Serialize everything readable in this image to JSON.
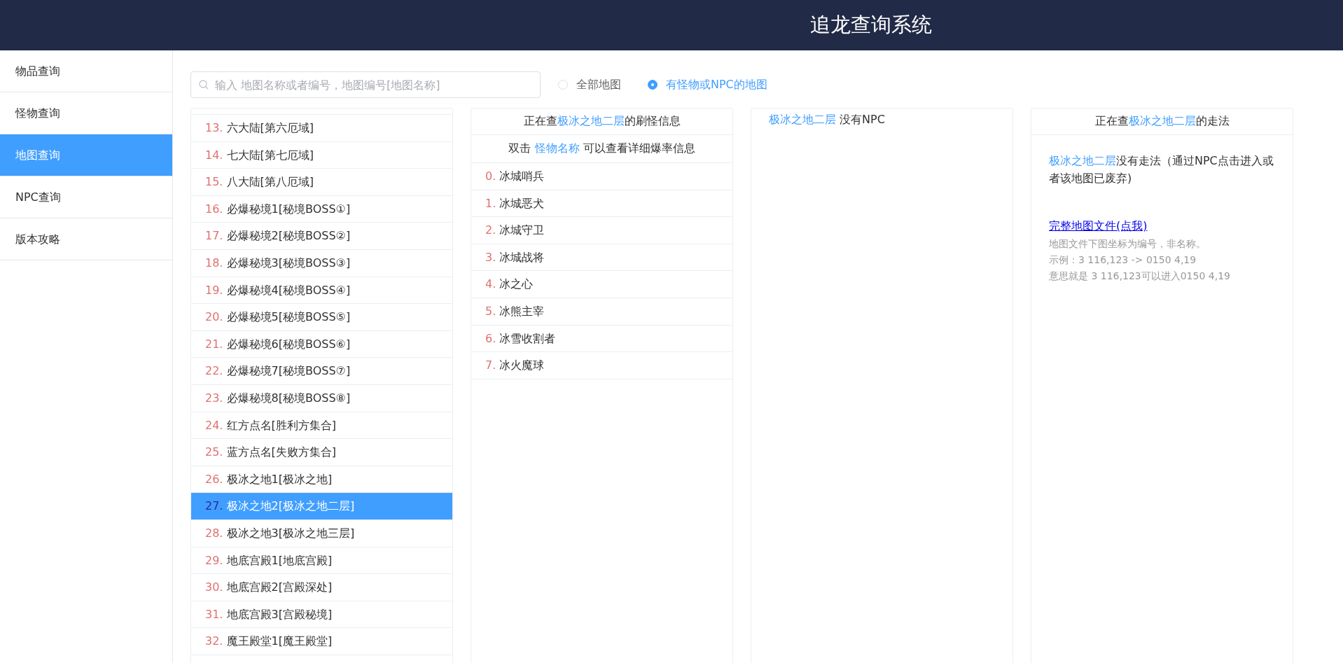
{
  "header": {
    "title": "追龙查询系统"
  },
  "sidebar": {
    "items": [
      {
        "label": "物品查询",
        "selected": false
      },
      {
        "label": "怪物查询",
        "selected": false
      },
      {
        "label": "地图查询",
        "selected": true
      },
      {
        "label": "NPC查询",
        "selected": false
      },
      {
        "label": "版本攻略",
        "selected": false
      }
    ]
  },
  "search": {
    "placeholder": "输入 地图名称或者编号，地图编号[地图名称]"
  },
  "filters": [
    {
      "label": "全部地图",
      "selected": false
    },
    {
      "label": "有怪物或NPC的地图",
      "selected": true
    }
  ],
  "map_list": [
    {
      "number": "13.",
      "name": "六大陆[第六厄域]",
      "selected": false
    },
    {
      "number": "14.",
      "name": "七大陆[第七厄域]",
      "selected": false
    },
    {
      "number": "15.",
      "name": "八大陆[第八厄域]",
      "selected": false
    },
    {
      "number": "16.",
      "name": "必爆秘境1[秘境BOSS①]",
      "selected": false
    },
    {
      "number": "17.",
      "name": "必爆秘境2[秘境BOSS②]",
      "selected": false
    },
    {
      "number": "18.",
      "name": "必爆秘境3[秘境BOSS③]",
      "selected": false
    },
    {
      "number": "19.",
      "name": "必爆秘境4[秘境BOSS④]",
      "selected": false
    },
    {
      "number": "20.",
      "name": "必爆秘境5[秘境BOSS⑤]",
      "selected": false
    },
    {
      "number": "21.",
      "name": "必爆秘境6[秘境BOSS⑥]",
      "selected": false
    },
    {
      "number": "22.",
      "name": "必爆秘境7[秘境BOSS⑦]",
      "selected": false
    },
    {
      "number": "23.",
      "name": "必爆秘境8[秘境BOSS⑧]",
      "selected": false
    },
    {
      "number": "24.",
      "name": "红方点名[胜利方集合]",
      "selected": false
    },
    {
      "number": "25.",
      "name": "蓝方点名[失败方集合]",
      "selected": false
    },
    {
      "number": "26.",
      "name": "极冰之地1[极冰之地]",
      "selected": false
    },
    {
      "number": "27.",
      "name": "极冰之地2[极冰之地二层]",
      "selected": true
    },
    {
      "number": "28.",
      "name": "极冰之地3[极冰之地三层]",
      "selected": false
    },
    {
      "number": "29.",
      "name": "地底宫殿1[地底宫殿]",
      "selected": false
    },
    {
      "number": "30.",
      "name": "地底宫殿2[宫殿深处]",
      "selected": false
    },
    {
      "number": "31.",
      "name": "地底宫殿3[宫殿秘境]",
      "selected": false
    },
    {
      "number": "32.",
      "name": "魔王殿堂1[魔王殿堂]",
      "selected": false
    }
  ],
  "monster_panel": {
    "title": {
      "before": "正在查",
      "highlight": "极冰之地二层",
      "after": "的刷怪信息"
    },
    "hint": {
      "before": "双击 ",
      "highlight": "怪物名称",
      "after": " 可以查看详细爆率信息"
    },
    "monsters": [
      {
        "number": "0.",
        "name": "冰城哨兵"
      },
      {
        "number": "1.",
        "name": "冰城恶犬"
      },
      {
        "number": "2.",
        "name": "冰城守卫"
      },
      {
        "number": "3.",
        "name": "冰城战将"
      },
      {
        "number": "4.",
        "name": "冰之心"
      },
      {
        "number": "5.",
        "name": "冰熊主宰"
      },
      {
        "number": "6.",
        "name": "冰雪收割者"
      },
      {
        "number": "7.",
        "name": "冰火魔球"
      }
    ]
  },
  "npc_panel": {
    "message": {
      "highlight": "极冰之地二层",
      "after": " 没有NPC"
    }
  },
  "route_panel": {
    "title": {
      "before": "正在查",
      "highlight": "极冰之地二层",
      "after": "的走法"
    },
    "message": {
      "highlight": "极冰之地二层",
      "after": "没有走法（通过NPC点击进入或者该地图已废弃)"
    },
    "link": "完整地图文件(点我)",
    "notes": [
      "地图文件下图坐标为编号，非名称。",
      "示例：3 116,123 -> 0150 4,19",
      "意思就是 3 116,123可以进入0150 4,19"
    ]
  }
}
